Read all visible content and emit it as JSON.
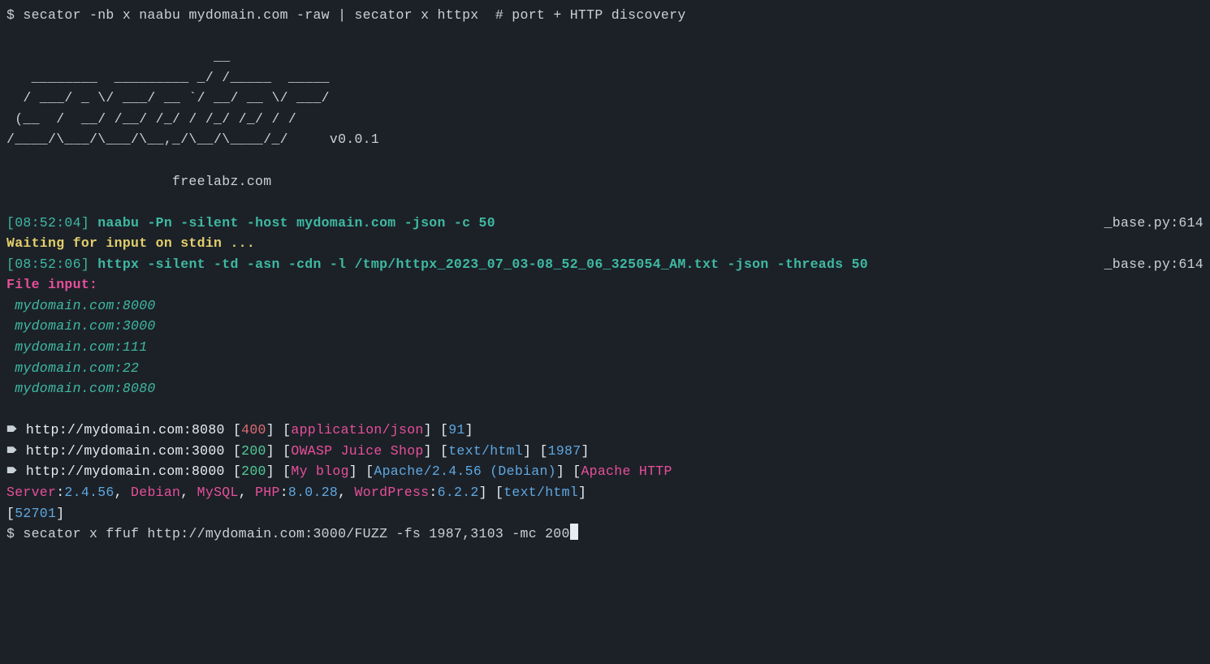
{
  "cmd1": {
    "prompt": "$",
    "text": "secator -nb x naabu mydomain.com -raw | secator x httpx ",
    "comment": " # port + HTTP discovery"
  },
  "ascii": {
    "l1": "                         __            ",
    "l2": "   ________  _________ _/ /_____  _____",
    "l3": "  / ___/ _ \\/ ___/ __ `/ __/ __ \\/ ___/",
    "l4": " (__  /  __/ /__/ /_/ / /_/ /_/ / /    ",
    "l5": "/____/\\___/\\___/\\__,_/\\__/\\____/_/     v0.0.1",
    "footer": "                    freelabz.com"
  },
  "log1": {
    "ts": "[08:52:04]",
    "cmd": "naabu -Pn -silent -host mydomain.com -json -c 50",
    "src": "_base.py:614"
  },
  "waiting": "Waiting for input on stdin ...",
  "log2": {
    "ts": "[08:52:06]",
    "cmd": "httpx -silent -td -asn -cdn -l /tmp/httpx_2023_07_03-08_52_06_325054_AM.txt -json -threads 50",
    "src": "_base.py:614"
  },
  "file_input_label": "File input:",
  "inputs": [
    " mydomain.com:8000",
    " mydomain.com:3000",
    " mydomain.com:111",
    " mydomain.com:22",
    " mydomain.com:8080"
  ],
  "results": [
    {
      "bullet": "🠶 ",
      "url": "http://mydomain.com:8080",
      "status": "400",
      "status_class": "c-red",
      "mime": "application/json",
      "size": "91",
      "title": null,
      "tech_parts": null
    },
    {
      "bullet": "🠶 ",
      "url": "http://mydomain.com:3000",
      "status": "200",
      "status_class": "c-green",
      "title": "OWASP Juice Shop",
      "mime": "text/html",
      "size": "1987",
      "tech_parts": null
    },
    {
      "bullet": "🠶 ",
      "url": "http://mydomain.com:8000",
      "status": "200",
      "status_class": "c-green",
      "title": "My blog",
      "tech_full": true,
      "mime": "text/html",
      "size": "52701"
    }
  ],
  "tech": {
    "server": "Apache/2.4.56 (Debian)",
    "parts": [
      {
        "name": "Apache HTTP Server",
        "ver": "2.4.56"
      },
      {
        "name": "Debian",
        "ver": null
      },
      {
        "name": "MySQL",
        "ver": null
      },
      {
        "name": "PHP",
        "ver": "8.0.28"
      },
      {
        "name": "WordPress",
        "ver": "6.2.2"
      }
    ]
  },
  "cmd2": {
    "prompt": "$",
    "text": "secator x ffuf http://mydomain.com:3000/FUZZ -fs 1987,3103 -mc 200"
  }
}
